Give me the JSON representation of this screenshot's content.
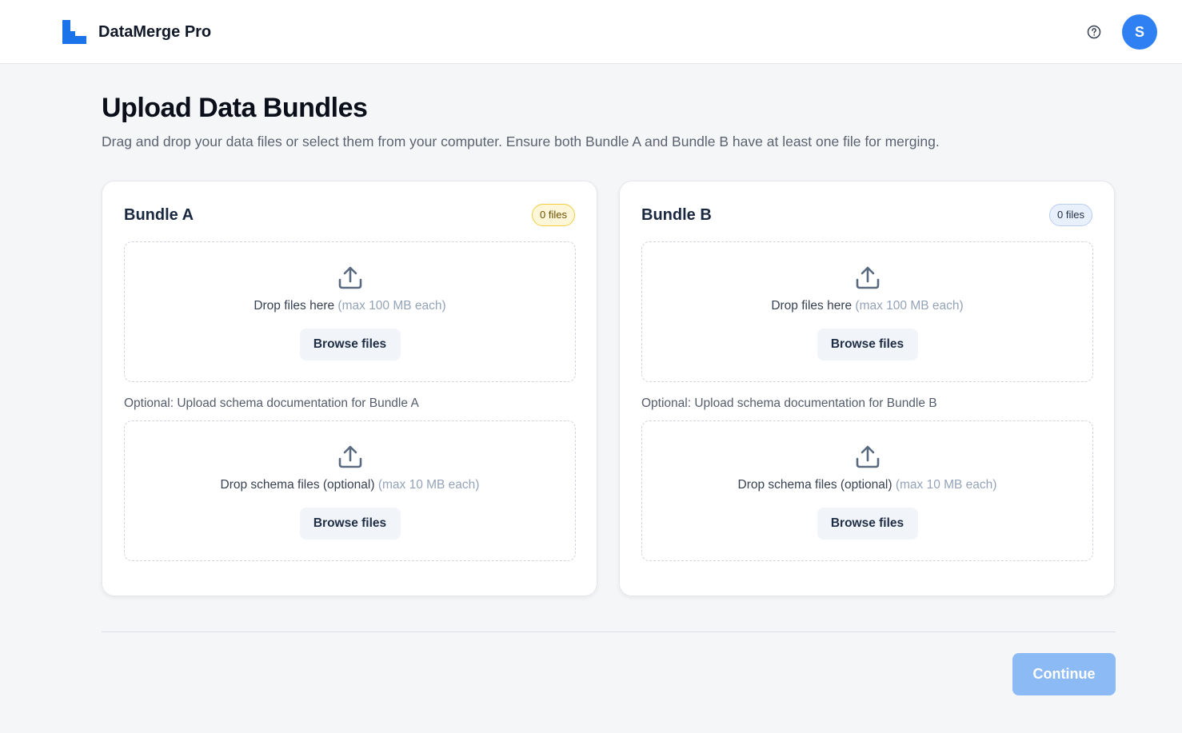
{
  "app": {
    "title": "DataMerge Pro",
    "brand_color": "#1a73e8",
    "logo_icon": "stair-logo-icon",
    "help_icon": "question-circle-icon",
    "avatar_initial": "S",
    "avatar_color": "#2f80f2"
  },
  "page": {
    "title": "Upload Data Bundles",
    "description": "Drag and drop your data files or select them from your computer. Ensure both Bundle A and Bundle B have at least one file for merging."
  },
  "bundles": [
    {
      "title": "Bundle A",
      "badge": "0 files",
      "badge_color": "#f2cf3f",
      "dropzone": {
        "icon": "upload-icon",
        "text": "Drop files here",
        "hint": "(max 100 MB each)",
        "button": "Browse files"
      },
      "schema_label": "Optional: Upload schema documentation for Bundle A",
      "schema_dropzone": {
        "icon": "upload-icon",
        "text": "Drop schema files (optional)",
        "hint": "(max 10 MB each)",
        "button": "Browse files"
      }
    },
    {
      "title": "Bundle B",
      "badge": "0 files",
      "badge_color": "#b9cdee",
      "dropzone": {
        "icon": "upload-icon",
        "text": "Drop files here",
        "hint": "(max 100 MB each)",
        "button": "Browse files"
      },
      "schema_label": "Optional: Upload schema documentation for Bundle B",
      "schema_dropzone": {
        "icon": "upload-icon",
        "text": "Drop schema files (optional)",
        "hint": "(max 10 MB each)",
        "button": "Browse files"
      }
    }
  ],
  "footer": {
    "continue_label": "Continue",
    "continue_color": "#8cbaf4"
  }
}
